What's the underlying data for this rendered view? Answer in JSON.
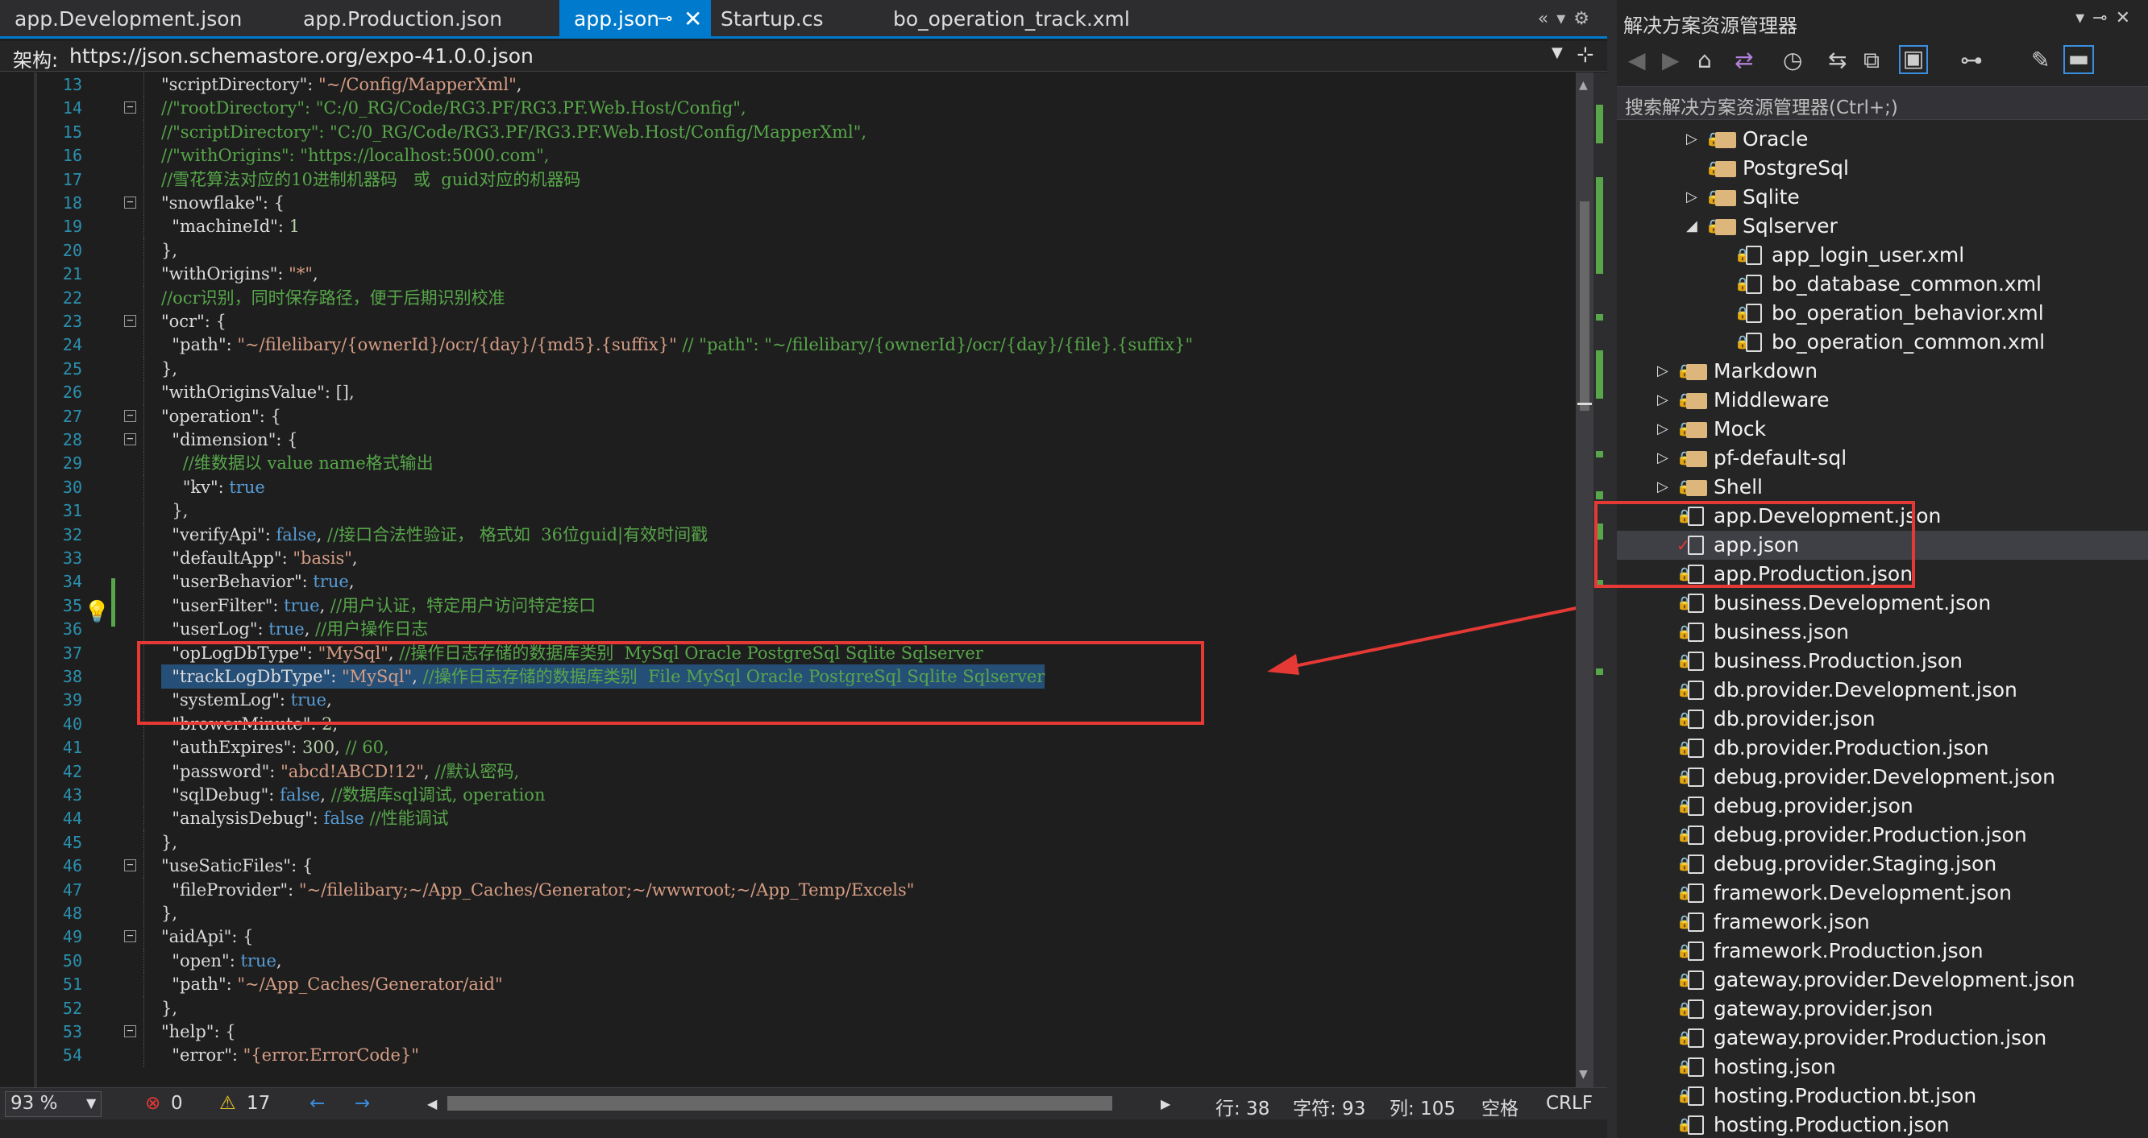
{
  "tabs": [
    {
      "label": "app.Development.json"
    },
    {
      "label": "app.Production.json"
    },
    {
      "label": "app.json"
    },
    {
      "label": "Startup.cs"
    },
    {
      "label": "bo_operation_track.xml"
    }
  ],
  "schema": {
    "label": "架构:",
    "url": "https://json.schemastore.org/expo-41.0.0.json"
  },
  "code_lines": [
    {
      "n": "13",
      "text": "\"scriptDirectory\": \"~/Config/MapperXml\","
    },
    {
      "n": "14",
      "text": "//\"rootDirectory\": \"C:/0_RG/Code/RG3.PF/RG3.PF.Web.Host/Config\","
    },
    {
      "n": "15",
      "text": "//\"scriptDirectory\": \"C:/0_RG/Code/RG3.PF/RG3.PF.Web.Host/Config/MapperXml\","
    },
    {
      "n": "16",
      "text": "//\"withOrigins\": \"https://localhost:5000.com\","
    },
    {
      "n": "17",
      "text": "//雪花算法对应的10进制机器码   或  guid对应的机器码"
    },
    {
      "n": "18",
      "text": "\"snowflake\": {"
    },
    {
      "n": "19",
      "text": "  \"machineId\": 1"
    },
    {
      "n": "20",
      "text": "},"
    },
    {
      "n": "21",
      "text": "\"withOrigins\": \"*\","
    },
    {
      "n": "22",
      "text": "//ocr识别，同时保存路径，便于后期识别校准"
    },
    {
      "n": "23",
      "text": "\"ocr\": {"
    },
    {
      "n": "24",
      "text": "  \"path\": \"~/filelibary/{ownerId}/ocr/{day}/{md5}.{suffix}\" // \"path\": \"~/filelibary/{ownerId}/ocr/{day}/{file}.{suffix}\""
    },
    {
      "n": "25",
      "text": "},"
    },
    {
      "n": "26",
      "text": "\"withOriginsValue\": [],"
    },
    {
      "n": "27",
      "text": "\"operation\": {"
    },
    {
      "n": "28",
      "text": "  \"dimension\": {"
    },
    {
      "n": "29",
      "text": "    //维数据以 value name格式输出"
    },
    {
      "n": "30",
      "text": "    \"kv\": true"
    },
    {
      "n": "31",
      "text": "  },"
    },
    {
      "n": "32",
      "text": "  \"verifyApi\": false, //接口合法性验证， 格式如  36位guid|有效时间戳"
    },
    {
      "n": "33",
      "text": "  \"defaultApp\": \"basis\","
    },
    {
      "n": "34",
      "text": "  \"userBehavior\": true,"
    },
    {
      "n": "35",
      "text": "  \"userFilter\": true, //用户认证，特定用户访问特定接口"
    },
    {
      "n": "36",
      "text": "  \"userLog\": true, //用户操作日志"
    },
    {
      "n": "37",
      "text": "  \"opLogDbType\": \"MySql\", //操作日志存储的数据库类别  MySql Oracle PostgreSql Sqlite Sqlserver"
    },
    {
      "n": "38",
      "text": "  \"trackLogDbType\": \"MySql\", //操作日志存储的数据库类别  File MySql Oracle PostgreSql Sqlite Sqlserver"
    },
    {
      "n": "39",
      "text": "  \"systemLog\": true,"
    },
    {
      "n": "40",
      "text": "  \"browerMinute\": 2,"
    },
    {
      "n": "41",
      "text": "  \"authExpires\": 300, // 60,"
    },
    {
      "n": "42",
      "text": "  \"password\": \"abcd!ABCD!12\", //默认密码,"
    },
    {
      "n": "43",
      "text": "  \"sqlDebug\": false, //数据库sql调试, operation"
    },
    {
      "n": "44",
      "text": "  \"analysisDebug\": false //性能调试"
    },
    {
      "n": "45",
      "text": "},"
    },
    {
      "n": "46",
      "text": "\"useSaticFiles\": {"
    },
    {
      "n": "47",
      "text": "  \"fileProvider\": \"~/filelibary;~/App_Caches/Generator;~/wwwroot;~/App_Temp/Excels\""
    },
    {
      "n": "48",
      "text": "},"
    },
    {
      "n": "49",
      "text": "\"aidApi\": {"
    },
    {
      "n": "50",
      "text": "  \"open\": true,"
    },
    {
      "n": "51",
      "text": "  \"path\": \"~/App_Caches/Generator/aid\""
    },
    {
      "n": "52",
      "text": "},"
    },
    {
      "n": "53",
      "text": "\"help\": {"
    },
    {
      "n": "54",
      "text": "  \"error\": \"{error.ErrorCode}\""
    }
  ],
  "status": {
    "zoom": "93 %",
    "errors": "0",
    "warnings": "17",
    "line": "行: 38",
    "char": "字符: 93",
    "col": "列: 105",
    "space": "空格",
    "eol": "CRLF"
  },
  "solution": {
    "title": "解决方案资源管理器",
    "search_placeholder": "搜索解决方案资源管理器(Ctrl+;)",
    "items": [
      {
        "label": "Oracle",
        "kind": "folder",
        "depth": 2,
        "expander": "collapsed"
      },
      {
        "label": "PostgreSql",
        "kind": "folder",
        "depth": 2,
        "expander": "none"
      },
      {
        "label": "Sqlite",
        "kind": "folder",
        "depth": 2,
        "expander": "collapsed"
      },
      {
        "label": "Sqlserver",
        "kind": "folder",
        "depth": 2,
        "expander": "expanded"
      },
      {
        "label": "app_login_user.xml",
        "kind": "xml",
        "depth": 3,
        "expander": "none"
      },
      {
        "label": "bo_database_common.xml",
        "kind": "xml",
        "depth": 3,
        "expander": "none"
      },
      {
        "label": "bo_operation_behavior.xml",
        "kind": "xml",
        "depth": 3,
        "expander": "none"
      },
      {
        "label": "bo_operation_common.xml",
        "kind": "xml",
        "depth": 3,
        "expander": "none"
      },
      {
        "label": "Markdown",
        "kind": "folder",
        "depth": 1,
        "expander": "collapsed"
      },
      {
        "label": "Middleware",
        "kind": "folder",
        "depth": 1,
        "expander": "collapsed"
      },
      {
        "label": "Mock",
        "kind": "folder",
        "depth": 1,
        "expander": "collapsed"
      },
      {
        "label": "pf-default-sql",
        "kind": "folder",
        "depth": 1,
        "expander": "collapsed"
      },
      {
        "label": "Shell",
        "kind": "folder",
        "depth": 1,
        "expander": "collapsed"
      },
      {
        "label": "app.Development.json",
        "kind": "json",
        "depth": 1,
        "expander": "none"
      },
      {
        "label": "app.json",
        "kind": "json",
        "depth": 1,
        "expander": "none",
        "selected": true
      },
      {
        "label": "app.Production.json",
        "kind": "json",
        "depth": 1,
        "expander": "none"
      },
      {
        "label": "business.Development.json",
        "kind": "json",
        "depth": 1,
        "expander": "none"
      },
      {
        "label": "business.json",
        "kind": "json",
        "depth": 1,
        "expander": "none"
      },
      {
        "label": "business.Production.json",
        "kind": "json",
        "depth": 1,
        "expander": "none"
      },
      {
        "label": "db.provider.Development.json",
        "kind": "json",
        "depth": 1,
        "expander": "none"
      },
      {
        "label": "db.provider.json",
        "kind": "json",
        "depth": 1,
        "expander": "none"
      },
      {
        "label": "db.provider.Production.json",
        "kind": "json",
        "depth": 1,
        "expander": "none"
      },
      {
        "label": "debug.provider.Development.json",
        "kind": "json",
        "depth": 1,
        "expander": "none"
      },
      {
        "label": "debug.provider.json",
        "kind": "json",
        "depth": 1,
        "expander": "none"
      },
      {
        "label": "debug.provider.Production.json",
        "kind": "json",
        "depth": 1,
        "expander": "none"
      },
      {
        "label": "debug.provider.Staging.json",
        "kind": "json",
        "depth": 1,
        "expander": "none"
      },
      {
        "label": "framework.Development.json",
        "kind": "json",
        "depth": 1,
        "expander": "none"
      },
      {
        "label": "framework.json",
        "kind": "json",
        "depth": 1,
        "expander": "none"
      },
      {
        "label": "framework.Production.json",
        "kind": "json",
        "depth": 1,
        "expander": "none"
      },
      {
        "label": "gateway.provider.Development.json",
        "kind": "json",
        "depth": 1,
        "expander": "none"
      },
      {
        "label": "gateway.provider.json",
        "kind": "json",
        "depth": 1,
        "expander": "none"
      },
      {
        "label": "gateway.provider.Production.json",
        "kind": "json",
        "depth": 1,
        "expander": "none"
      },
      {
        "label": "hosting.json",
        "kind": "json",
        "depth": 1,
        "expander": "none"
      },
      {
        "label": "hosting.Production.bt.json",
        "kind": "json",
        "depth": 1,
        "expander": "none"
      },
      {
        "label": "hosting.Production.json",
        "kind": "json",
        "depth": 1,
        "expander": "none"
      }
    ]
  },
  "colors": {
    "accent": "#007acc",
    "annotation_red": "#e53935",
    "comment": "#57a64a",
    "string": "#d69d85",
    "keyword": "#569cd6",
    "line_number": "#2b91af"
  }
}
